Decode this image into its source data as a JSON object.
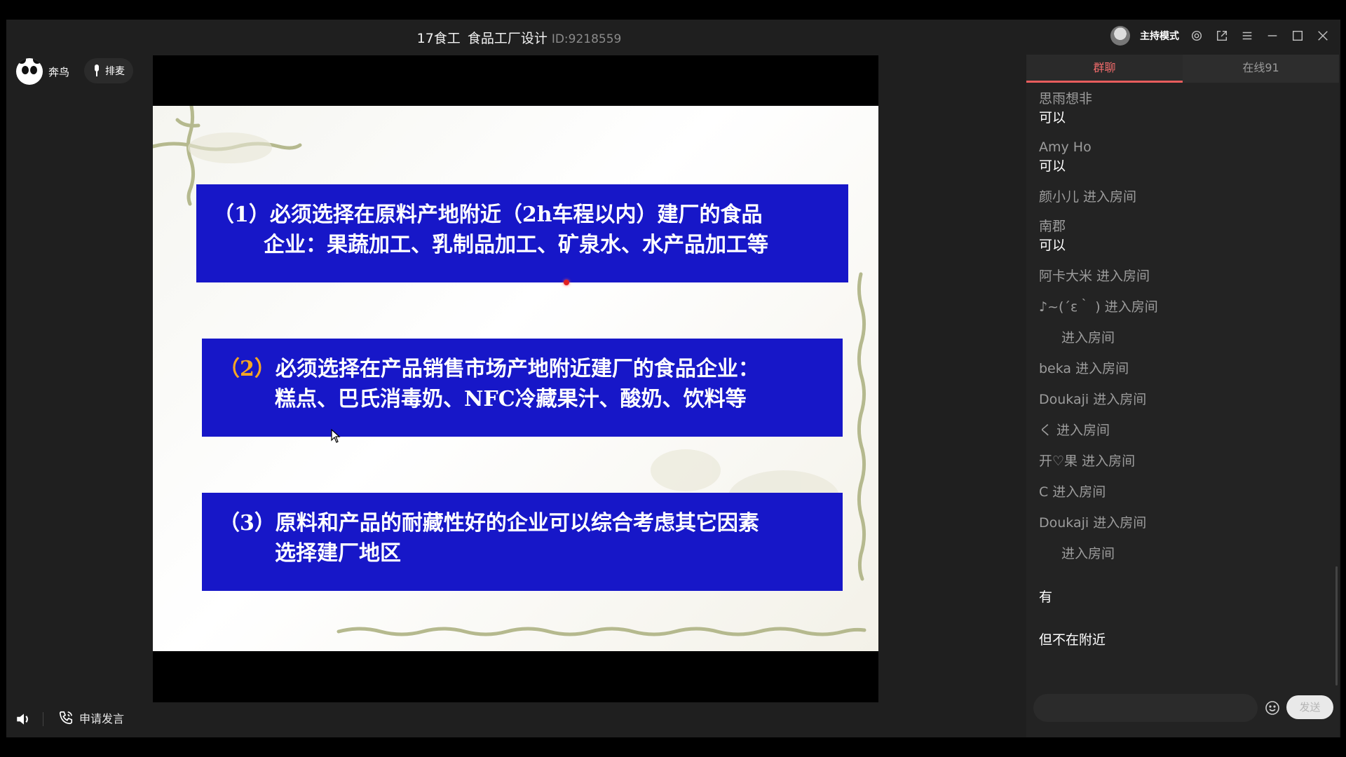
{
  "window": {
    "course_name": "17食工",
    "session_title": "食品工厂设计",
    "room_id": "ID:9218559",
    "host_mode_label": "主持模式",
    "icons": [
      "settings-icon",
      "popout-icon",
      "menu-icon",
      "minimize-icon",
      "maximize-icon",
      "close-icon"
    ]
  },
  "left": {
    "user_name": "奔鸟",
    "queue_label": "排麦",
    "apply_speak_label": "申请发言"
  },
  "slide": {
    "items": [
      {
        "number": "（1）",
        "line1": "必须选择在原料产地附近（2h车程以内）建厂的食品",
        "line2": "企业：果蔬加工、乳制品加工、矿泉水、水产品加工等"
      },
      {
        "number": "（2）",
        "line1": "必须选择在产品销售市场产地附近建厂的食品企业：",
        "line2": "糕点、巴氏消毒奶、NFC冷藏果汁、酸奶、饮料等"
      },
      {
        "number": "（3）",
        "line1": "原料和产品的耐藏性好的企业可以综合考虑其它因素",
        "line2": "选择建厂地区"
      }
    ],
    "colors": {
      "box": "#1717c8",
      "text": "#ffffff",
      "accent_number": "#f6a623"
    }
  },
  "chat": {
    "tabs": [
      {
        "label": "群聊",
        "active": true
      },
      {
        "label": "在线91",
        "active": false
      }
    ],
    "messages": [
      {
        "type": "user",
        "sender": "思雨想非",
        "text": "可以"
      },
      {
        "type": "user",
        "sender": "Amy Ho",
        "text": "可以"
      },
      {
        "type": "system",
        "text": "颜小儿 进入房间"
      },
      {
        "type": "user",
        "sender": "南郡",
        "text": "可以"
      },
      {
        "type": "system",
        "text": "阿卡大米 进入房间"
      },
      {
        "type": "system",
        "text": "♪~(´ε｀ ) 进入房间"
      },
      {
        "type": "system-indent",
        "text": "进入房间"
      },
      {
        "type": "system",
        "text": "beka 进入房间"
      },
      {
        "type": "system",
        "text": "Doukaji 进入房间"
      },
      {
        "type": "system",
        "text": "く 进入房间"
      },
      {
        "type": "system",
        "text": "开♡果 进入房间"
      },
      {
        "type": "system",
        "text": "C 进入房间"
      },
      {
        "type": "system",
        "text": "Doukaji 进入房间"
      },
      {
        "type": "system-indent",
        "text": "进入房间"
      },
      {
        "type": "text-only",
        "text": "有"
      },
      {
        "type": "text-only",
        "text": "但不在附近"
      }
    ],
    "input_placeholder": "",
    "send_label": "发送"
  }
}
